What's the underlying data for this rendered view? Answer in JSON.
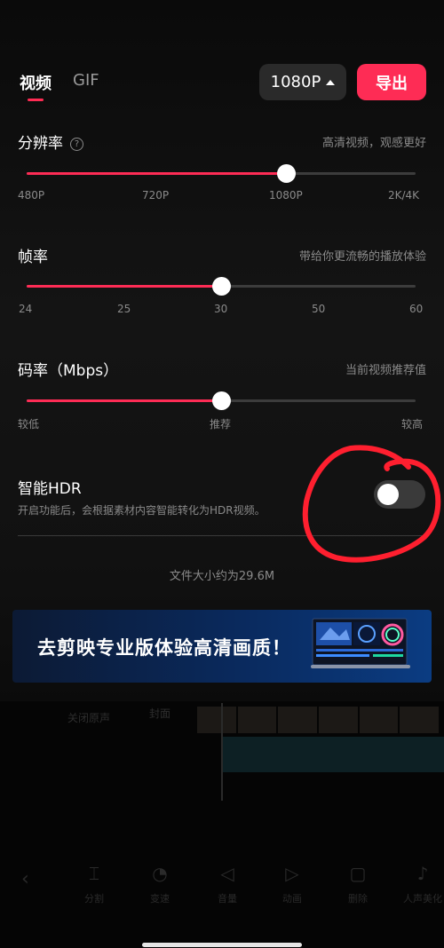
{
  "header": {
    "tabs": [
      {
        "label": "视频",
        "active": true
      },
      {
        "label": "GIF",
        "active": false
      }
    ],
    "resolution_label": "1080P",
    "export_label": "导出"
  },
  "settings": {
    "resolution": {
      "label": "分辨率",
      "hint": "高清视频，观感更好",
      "ticks": [
        "480P",
        "720P",
        "1080P",
        "2K/4K"
      ],
      "selected": "1080P"
    },
    "frame_rate": {
      "label": "帧率",
      "hint": "带给你更流畅的播放体验",
      "ticks": [
        "24",
        "25",
        "30",
        "50",
        "60"
      ],
      "selected": "30"
    },
    "bitrate": {
      "label": "码率（Mbps）",
      "hint": "当前视频推荐值",
      "ticks": [
        "较低",
        "推荐",
        "较高"
      ],
      "selected": "推荐"
    }
  },
  "hdr": {
    "title": "智能HDR",
    "description": "开启功能后，会根据素材内容智能转化为HDR视频。",
    "enabled": false
  },
  "file_size": "文件大小约为29.6M",
  "banner": {
    "text": "去剪映专业版体验高清画质！"
  },
  "editor_background": {
    "mute_label": "关闭原声",
    "cover_label": "封面",
    "tools": [
      "分割",
      "变速",
      "音量",
      "动画",
      "删除",
      "人声美化"
    ]
  },
  "colors": {
    "accent": "#fe2c55",
    "annotation": "#ff1f2f"
  }
}
